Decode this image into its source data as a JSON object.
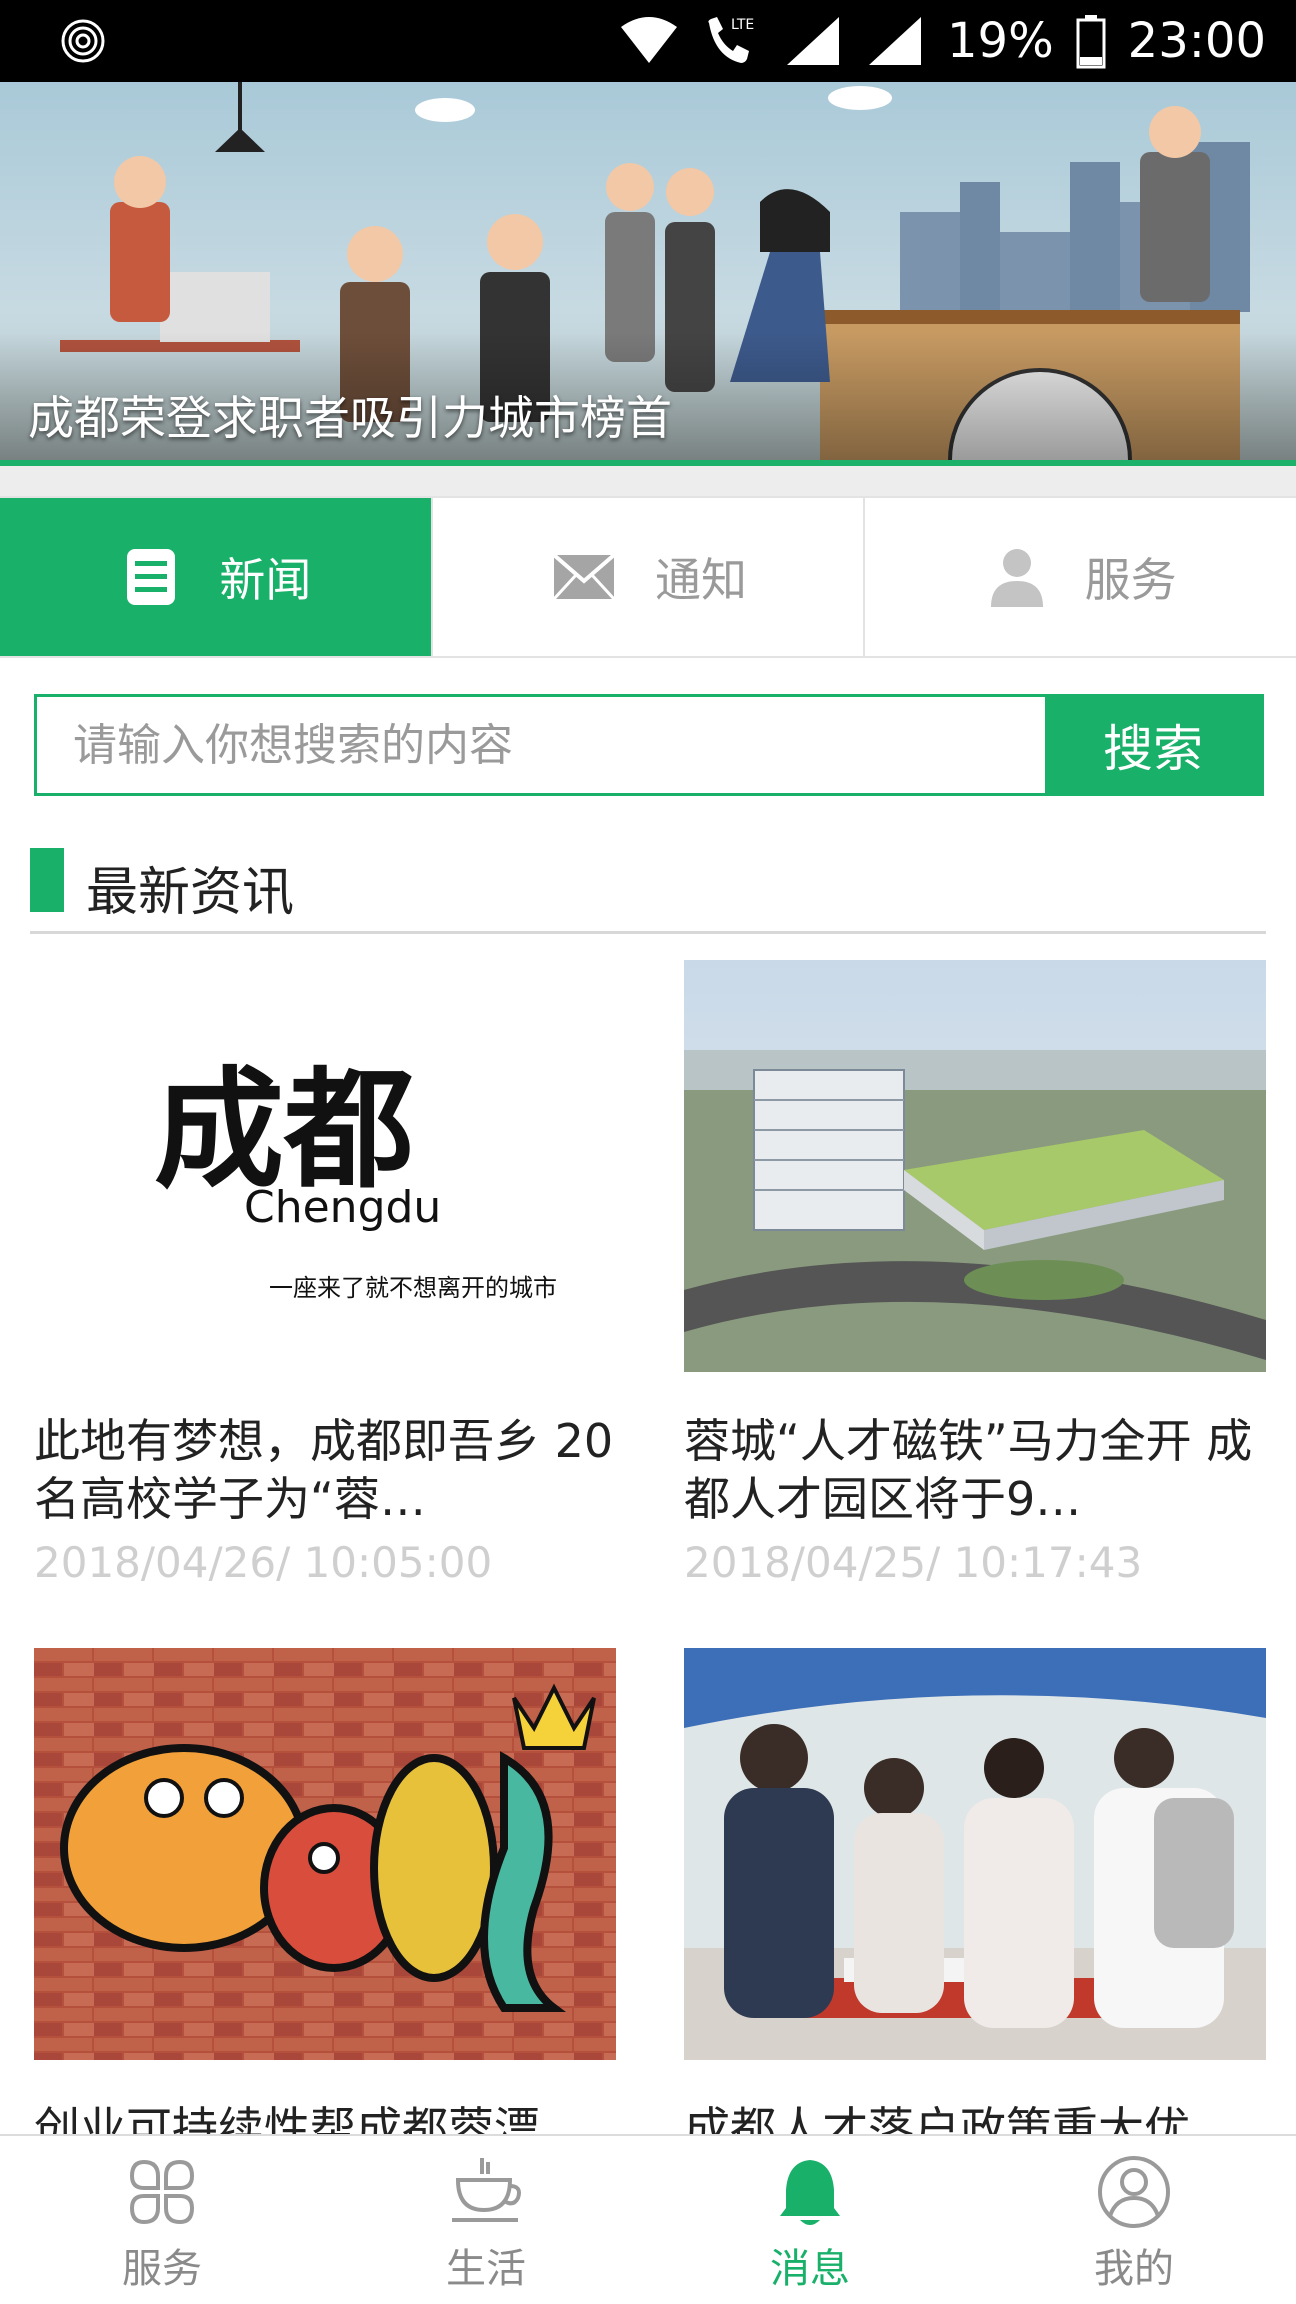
{
  "status_bar": {
    "battery": "19%",
    "time": "23:00",
    "network": "LTE"
  },
  "banner": {
    "caption": "成都荣登求职者吸引力城市榜首"
  },
  "tabs": [
    {
      "label": "新闻",
      "icon": "document-icon",
      "active": true
    },
    {
      "label": "通知",
      "icon": "mail-icon",
      "active": false
    },
    {
      "label": "服务",
      "icon": "person-icon",
      "active": false
    }
  ],
  "search": {
    "placeholder": "请输入你想搜索的内容",
    "button": "搜索"
  },
  "section": {
    "title": "最新资讯"
  },
  "news": [
    {
      "title": "此地有梦想，成都即吾乡 20名高校学子为“蓉…",
      "date": "2018/04/26/ 10:05:00",
      "image": "chengdu-logo",
      "image_text_main": "成都",
      "image_text_sub": "Chengdu",
      "image_text_slogan": "一座来了就不想离开的城市"
    },
    {
      "title": "蓉城“人才磁铁”马力全开 成都人才园区将于9…",
      "date": "2018/04/25/ 10:17:43",
      "image": "aerial-building"
    },
    {
      "title": "创业可持续性帮成都蓉漂",
      "date": "",
      "image": "graffiti-wall"
    },
    {
      "title": "成都人才落户政策重大优",
      "date": "",
      "image": "job-fair"
    }
  ],
  "bottom_nav": [
    {
      "label": "服务",
      "icon": "services-icon",
      "active": false
    },
    {
      "label": "生活",
      "icon": "coffee-cup-icon",
      "active": false
    },
    {
      "label": "消息",
      "icon": "bell-icon",
      "active": true
    },
    {
      "label": "我的",
      "icon": "profile-icon",
      "active": false
    }
  ],
  "colors": {
    "accent": "#19b06a",
    "muted": "#9a9a9a"
  }
}
